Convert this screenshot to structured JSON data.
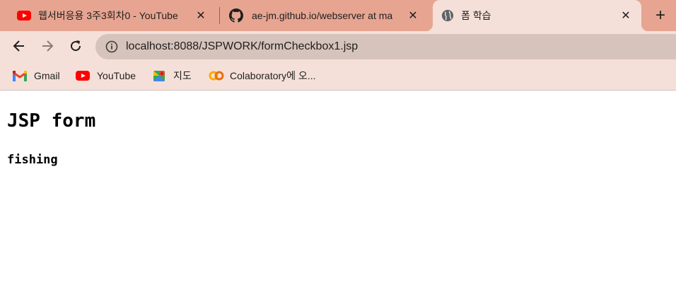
{
  "tabs": [
    {
      "title": "웹서버응용 3주3회차0 - YouTube",
      "icon": "youtube-icon",
      "active": false
    },
    {
      "title": "ae-jm.github.io/webserver at ma",
      "icon": "github-icon",
      "active": false
    },
    {
      "title": "폼 학습",
      "icon": "globe-icon",
      "active": true
    }
  ],
  "new_tab": "+",
  "close_glyph": "✕",
  "address_bar": {
    "url": "localhost:8088/JSPWORK/formCheckbox1.jsp"
  },
  "bookmarks": [
    {
      "label": "Gmail",
      "icon": "gmail-icon"
    },
    {
      "label": "YouTube",
      "icon": "youtube-icon"
    },
    {
      "label": "지도",
      "icon": "maps-icon"
    },
    {
      "label": "Colaboratory에 오...",
      "icon": "colab-icon"
    }
  ],
  "page": {
    "heading": "JSP form",
    "result": "fishing"
  },
  "colors": {
    "tabstrip": "#e7a591",
    "toolbar": "#f5e0d9",
    "omnibox": "#d6c3bc",
    "youtube_red": "#ff0000"
  }
}
